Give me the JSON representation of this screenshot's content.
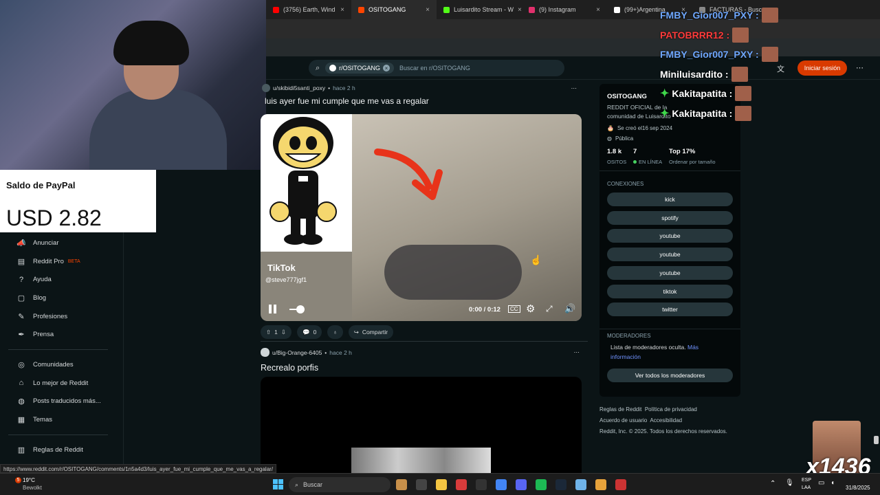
{
  "browser": {
    "tabs": [
      {
        "label": "(3756) Earth, Wind",
        "color": "#ff0000"
      },
      {
        "label": "OSITOGANG",
        "color": "#ff4500",
        "active": true
      },
      {
        "label": "Luisardito Stream - W",
        "color": "#53fc18"
      },
      {
        "label": "(9) Instagram",
        "color": "#e1306c"
      },
      {
        "label": "(99+)Argentina",
        "color": "#ffffff"
      },
      {
        "label": "FACTURAS - Buscar",
        "color": "#888888"
      }
    ],
    "status_url": "https://www.reddit.com/r/OSITOGANG/comments/1n5a4d3/luis_ayer_fue_mi_cumple_que_me_vas_a_regalar/"
  },
  "header": {
    "subreddit_chip": "r/OSITOGANG",
    "search_placeholder": "Buscar en r/OSITOGANG",
    "login_label": "Iniciar sesión"
  },
  "paypal": {
    "title": "Saldo de PayPal",
    "amount": "USD 2.82"
  },
  "sidebar": {
    "items": [
      {
        "label": "Anunciar",
        "icon": "megaphone-icon",
        "glyph": "📣"
      },
      {
        "label": "Reddit Pro",
        "badge": "BETA",
        "icon": "reddit-pro-icon",
        "glyph": "▤"
      },
      {
        "label": "Ayuda",
        "icon": "help-icon",
        "glyph": "?"
      },
      {
        "label": "Blog",
        "icon": "blog-icon",
        "glyph": "▢"
      },
      {
        "label": "Profesiones",
        "icon": "wrench-icon",
        "glyph": "✎"
      },
      {
        "label": "Prensa",
        "icon": "press-icon",
        "glyph": "✒"
      }
    ],
    "items2": [
      {
        "label": "Comunidades",
        "icon": "communities-icon",
        "glyph": "◎"
      },
      {
        "label": "Lo mejor de Reddit",
        "icon": "best-icon",
        "glyph": "⌂"
      },
      {
        "label": "Posts traducidos más...",
        "icon": "globe-icon",
        "glyph": "◍"
      },
      {
        "label": "Temas",
        "icon": "topics-icon",
        "glyph": "▦"
      }
    ],
    "items3": [
      {
        "label": "Reglas de Reddit",
        "icon": "rules-icon",
        "glyph": "▥"
      }
    ]
  },
  "post1": {
    "author": "u/skibidi5santi_poxy",
    "time": "hace 2 h",
    "title": "luis ayer fue mi cumple que me vas a regalar",
    "video_watermark": "TikTok",
    "video_handle": "@steve777jgf1",
    "video_time": "0:00 / 0:12",
    "votes": "1",
    "comments": "0",
    "share_label": "Compartir"
  },
  "post2": {
    "author": "u/Big-Orange-6405",
    "time": "hace 2 h",
    "title": "Recrealo porfis"
  },
  "community": {
    "name": "OSITOGANG",
    "description": "REDDIT OFICIAL de la comunidad de Luisardito",
    "created": "Se creó el16 sep 2024",
    "visibility": "Pública",
    "members": "1.8 k",
    "members_label": "ositos",
    "online": "7",
    "online_label": "EN LÍNEA",
    "rank": "Top 17%",
    "rank_label": "Ordenar por tamaño",
    "connections_label": "CONEXIONES",
    "connections": [
      "kick",
      "spotify",
      "youtube",
      "youtube",
      "youtube",
      "tiktok",
      "twitter"
    ],
    "moderators_label": "MODERADORES",
    "moderators_text": "Lista de moderadores oculta.",
    "moderators_link": "Más información",
    "moderators_button": "Ver todos los moderadores"
  },
  "footer": {
    "links": [
      "Reglas de Reddit",
      "Política de privacidad",
      "Acuerdo de usuario",
      "Accesibilidad"
    ],
    "copyright": "Reddit, Inc. © 2025. Todos los derechos reservados."
  },
  "chat": [
    {
      "user": "FMBY_Gior007_PXY :",
      "color": "#6fa8ff"
    },
    {
      "user": "PATOBRRR12 :",
      "color": "#ff3b3b"
    },
    {
      "user": "FMBY_Gior007_PXY :",
      "color": "#6fa8ff"
    },
    {
      "user": "Miniluisardito :",
      "color": "#ffffff"
    },
    {
      "user": "Kakitapatita :",
      "color": "#ffffff"
    },
    {
      "user": "Kakitapatita :",
      "color": "#ffffff"
    }
  ],
  "overlay_counter": "x1436",
  "taskbar": {
    "weather_temp": "19°C",
    "weather_desc": "Bewolkt",
    "weather_badge": "5",
    "search_label": "Buscar",
    "lang": "ESP",
    "lang2": "LAA",
    "date": "31/8/2025"
  }
}
